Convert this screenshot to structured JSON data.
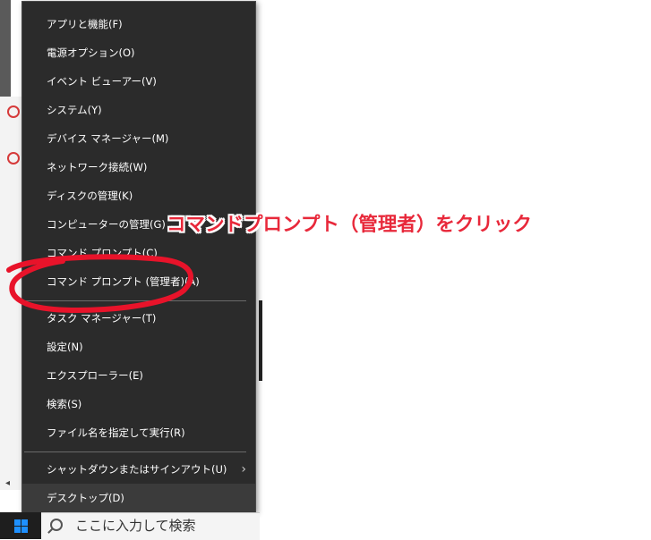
{
  "menu": {
    "items": [
      {
        "label": "アプリと機能(F)"
      },
      {
        "label": "電源オプション(O)"
      },
      {
        "label": "イベント ビューアー(V)"
      },
      {
        "label": "システム(Y)"
      },
      {
        "label": "デバイス マネージャー(M)"
      },
      {
        "label": "ネットワーク接続(W)"
      },
      {
        "label": "ディスクの管理(K)"
      },
      {
        "label": "コンピューターの管理(G)"
      },
      {
        "label": "コマンド プロンプト(C)"
      },
      {
        "label": "コマンド プロンプト (管理者)(A)"
      },
      {
        "label": "タスク マネージャー(T)"
      },
      {
        "label": "設定(N)"
      },
      {
        "label": "エクスプローラー(E)"
      },
      {
        "label": "検索(S)"
      },
      {
        "label": "ファイル名を指定して実行(R)"
      },
      {
        "label": "シャットダウンまたはサインアウト(U)"
      },
      {
        "label": "デスクトップ(D)"
      }
    ]
  },
  "annotation": {
    "text": "コマンドプロンプト（管理者）をクリック",
    "color": "#e8283a"
  },
  "taskbar": {
    "search_placeholder": "ここに入力して検索"
  },
  "colors": {
    "menu_bg": "#2b2b2b",
    "menu_text": "#ffffff",
    "highlight": "#3b3b3b",
    "start_logo": "#1e90ff"
  }
}
